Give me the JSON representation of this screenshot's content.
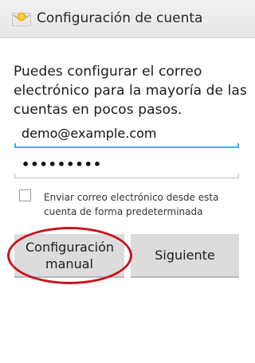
{
  "header": {
    "title": "Configuración de cuenta",
    "icon": "email-app-icon"
  },
  "intro_text": "Puedes configurar el correo electrónico para la mayoría de las cuentas en pocos pasos.",
  "email": {
    "value": "demo@example.com"
  },
  "password": {
    "value": "•••••••••"
  },
  "default_account": {
    "label": "Enviar correo electrónico desde esta cuenta de forma predeterminada",
    "checked": false
  },
  "buttons": {
    "manual_setup": "Configuración manual",
    "next": "Siguiente"
  },
  "colors": {
    "focus_accent": "#33b5e5",
    "annotation_ring": "#c8141c"
  }
}
